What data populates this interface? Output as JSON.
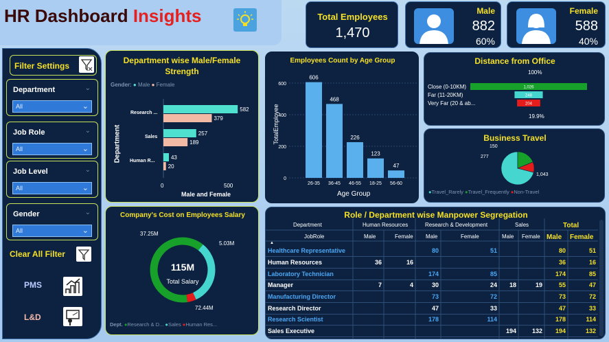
{
  "header": {
    "title_a": "HR Dashboard ",
    "title_b": "Insights"
  },
  "kpis": {
    "total_label": "Total Employees",
    "total_value": "1,470",
    "male_label": "Male",
    "male_value": "882",
    "male_pct": "60%",
    "female_label": "Female",
    "female_value": "588",
    "female_pct": "40%"
  },
  "filters": {
    "title": "Filter Settings",
    "items": [
      {
        "label": "Department",
        "value": "All"
      },
      {
        "label": "Job Role",
        "value": "All"
      },
      {
        "label": "Job Level",
        "value": "All"
      },
      {
        "label": "Gender",
        "value": "All"
      }
    ],
    "clear": "Clear All Filter",
    "pms": "PMS",
    "ld": "L&D"
  },
  "dept_chart": {
    "title": "Department wise Male/Female Strength",
    "legend_title": "Gender:",
    "legend": [
      "Male",
      "Female"
    ],
    "ylabel": "Department",
    "xlabel": "Male and Female",
    "ticks": [
      "0",
      "500"
    ],
    "cats": [
      "Research ...",
      "Sales",
      "Human R..."
    ]
  },
  "age_chart": {
    "title": "Employees Count by Age Group",
    "ylabel": "TotalEmployee",
    "xlabel": "Age Group",
    "ticks": [
      "0",
      "200",
      "400",
      "600"
    ]
  },
  "distance": {
    "title": "Distance from Office",
    "top": "100%",
    "bottom": "19.9%",
    "rows": [
      {
        "label": "Close (0-10KM)",
        "val": "1,026"
      },
      {
        "label": "Far (11-20KM)",
        "val": "248"
      },
      {
        "label": "Very Far (20 & ab...",
        "val": "204"
      }
    ]
  },
  "travel": {
    "title": "Business Travel",
    "labels": [
      "150",
      "277",
      "1,043"
    ],
    "legend": [
      "Travel_Rarely",
      "Travel_Frequently",
      "Non-Travel"
    ]
  },
  "salary": {
    "title": "Company's Cost on Employees Salary",
    "center_value": "115M",
    "center_label": "Total Salary",
    "labels": [
      "37.25M",
      "5.03M",
      "72.44M"
    ],
    "legend_title": "Dept.",
    "legend": [
      "Research & D...",
      "Sales",
      "Human Res..."
    ]
  },
  "matrix": {
    "title": "Role / Department wise Manpower Segregation",
    "dept_header": "Department",
    "role_header": "JobRole",
    "depts": [
      "Human Resources",
      "Research & Development",
      "Sales",
      "Total"
    ],
    "sub": [
      "Male",
      "Female"
    ],
    "rows": [
      {
        "role": "Healthcare Representative",
        "c": [
          "",
          "",
          "80",
          "51",
          "",
          "",
          "80",
          "51"
        ],
        "blue": true
      },
      {
        "role": "Human Resources",
        "c": [
          "36",
          "16",
          "",
          "",
          "",
          "",
          "36",
          "16"
        ],
        "blue": false
      },
      {
        "role": "Laboratory Technician",
        "c": [
          "",
          "",
          "174",
          "85",
          "",
          "",
          "174",
          "85"
        ],
        "blue": true
      },
      {
        "role": "Manager",
        "c": [
          "7",
          "4",
          "30",
          "24",
          "18",
          "19",
          "55",
          "47"
        ],
        "blue": false
      },
      {
        "role": "Manufacturing Director",
        "c": [
          "",
          "",
          "73",
          "72",
          "",
          "",
          "73",
          "72"
        ],
        "blue": true
      },
      {
        "role": "Research Director",
        "c": [
          "",
          "",
          "47",
          "33",
          "",
          "",
          "47",
          "33"
        ],
        "blue": false
      },
      {
        "role": "Research Scientist",
        "c": [
          "",
          "",
          "178",
          "114",
          "",
          "",
          "178",
          "114"
        ],
        "blue": true
      },
      {
        "role": "Sales Executive",
        "c": [
          "",
          "",
          "",
          "",
          "194",
          "132",
          "194",
          "132"
        ],
        "blue": false
      }
    ]
  },
  "colors": {
    "male": "#4fe0d0",
    "female": "#f2b9a5",
    "bar": "#5ab0ec",
    "green": "#17a02a",
    "red": "#e41c1c",
    "yellow": "#f5e028",
    "teal": "#45d6d0"
  },
  "chart_data": [
    {
      "type": "bar",
      "title": "Department wise Male/Female Strength",
      "categories": [
        "Research & Development",
        "Sales",
        "Human Resources"
      ],
      "series": [
        {
          "name": "Male",
          "values": [
            582,
            257,
            43
          ]
        },
        {
          "name": "Female",
          "values": [
            379,
            189,
            20
          ]
        }
      ],
      "xlabel": "Male and Female",
      "ylabel": "Department"
    },
    {
      "type": "bar",
      "title": "Employees Count by Age Group",
      "categories": [
        "26-35",
        "36-45",
        "46-55",
        "18-25",
        "56-60"
      ],
      "values": [
        606,
        468,
        226,
        123,
        47
      ],
      "xlabel": "Age Group",
      "ylabel": "TotalEmployee",
      "ylim": [
        0,
        650
      ]
    },
    {
      "type": "bar",
      "title": "Distance from Office",
      "categories": [
        "Close (0-10KM)",
        "Far (11-20KM)",
        "Very Far (20 & ab..."
      ],
      "values": [
        1026,
        248,
        204
      ]
    },
    {
      "type": "pie",
      "title": "Business Travel",
      "categories": [
        "Travel_Rarely",
        "Travel_Frequently",
        "Non-Travel"
      ],
      "values": [
        1043,
        277,
        150
      ]
    },
    {
      "type": "pie",
      "title": "Company's Cost on Employees Salary",
      "categories": [
        "Research & D...",
        "Sales",
        "Human Res..."
      ],
      "values": [
        72.44,
        37.25,
        5.03
      ]
    }
  ]
}
